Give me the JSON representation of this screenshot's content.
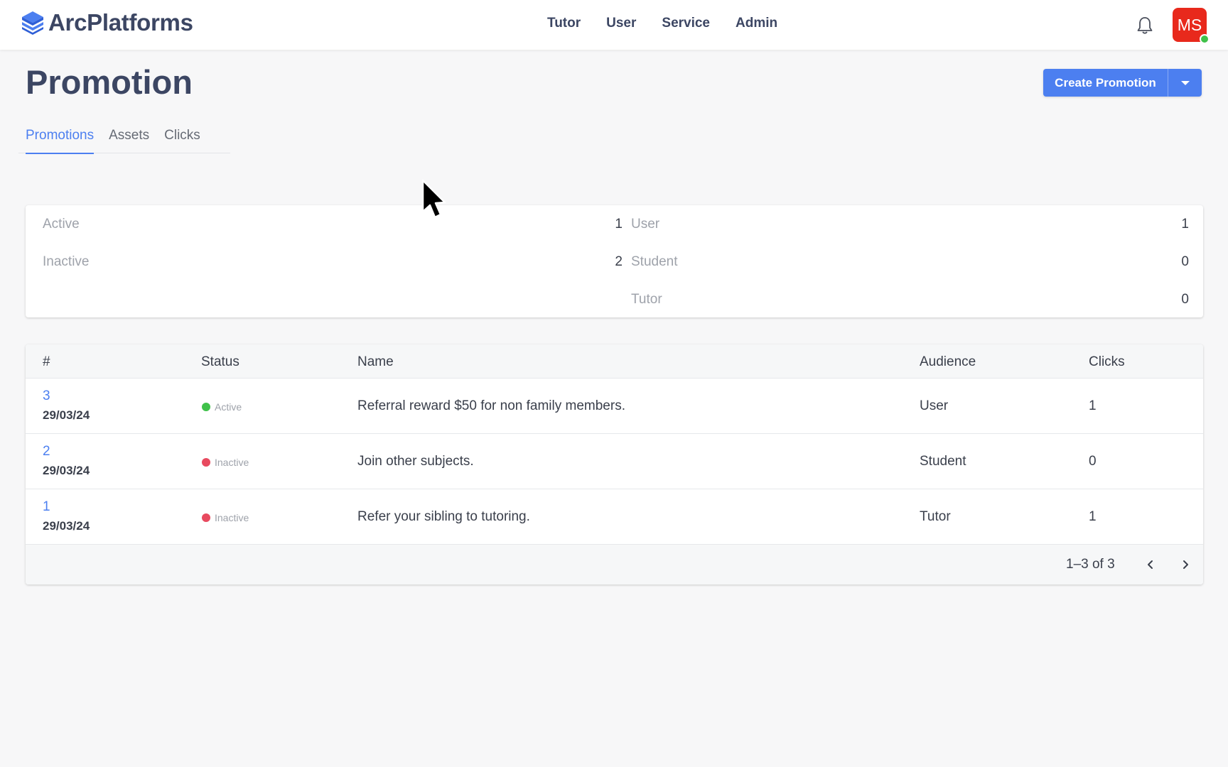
{
  "brand": {
    "name": "ArcPlatforms",
    "accent": "#4c7ff0"
  },
  "nav": {
    "items": [
      "Tutor",
      "User",
      "Service",
      "Admin"
    ]
  },
  "user": {
    "initials": "MS",
    "avatar_color": "#e8291c",
    "presence_color": "#3fc14a"
  },
  "page": {
    "title": "Promotion"
  },
  "actions": {
    "create_label": "Create Promotion"
  },
  "tabs": [
    {
      "label": "Promotions",
      "active": true
    },
    {
      "label": "Assets",
      "active": false
    },
    {
      "label": "Clicks",
      "active": false
    }
  ],
  "summary": {
    "status": [
      {
        "label": "Active",
        "value": "1"
      },
      {
        "label": "Inactive",
        "value": "2"
      }
    ],
    "audience": [
      {
        "label": "User",
        "value": "1"
      },
      {
        "label": "Student",
        "value": "0"
      },
      {
        "label": "Tutor",
        "value": "0"
      }
    ]
  },
  "table": {
    "columns": [
      "#",
      "Status",
      "Name",
      "Audience",
      "Clicks"
    ],
    "rows": [
      {
        "id": "3",
        "date": "29/03/24",
        "status": "Active",
        "status_color": "#3fc14a",
        "name": "Referral reward $50 for non family members.",
        "audience": "User",
        "clicks": "1"
      },
      {
        "id": "2",
        "date": "29/03/24",
        "status": "Inactive",
        "status_color": "#e84a5f",
        "name": "Join other subjects.",
        "audience": "Student",
        "clicks": "0"
      },
      {
        "id": "1",
        "date": "29/03/24",
        "status": "Inactive",
        "status_color": "#e84a5f",
        "name": "Refer your sibling to tutoring.",
        "audience": "Tutor",
        "clicks": "1"
      }
    ],
    "pagination": {
      "range": "1–3 of 3"
    }
  }
}
